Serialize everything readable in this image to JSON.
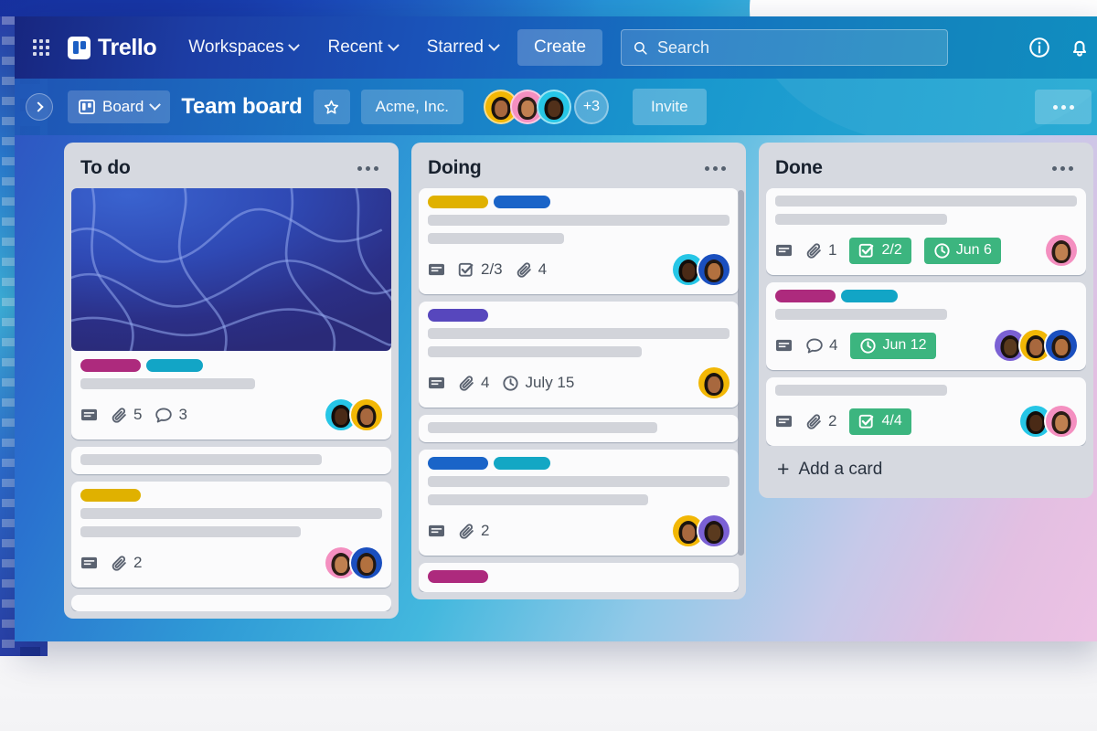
{
  "app": {
    "brand": "Trello",
    "nav": {
      "apps_icon": "grid-apps-icon",
      "workspaces": "Workspaces",
      "recent": "Recent",
      "starred": "Starred",
      "create": "Create",
      "search_placeholder": "Search",
      "search_value": "",
      "info_icon": "info-circle-icon",
      "notifications_icon": "bell-icon"
    },
    "board_header": {
      "sidebar_toggle_icon": "chevron-right-icon",
      "view_label": "Board",
      "view_icon": "board-view-icon",
      "title": "Team board",
      "star_icon": "star-icon",
      "workspace": "Acme, Inc.",
      "members_overflow": "+3",
      "invite": "Invite",
      "more_icon": "ellipsis-icon",
      "member_avatars": [
        {
          "name": "member-1",
          "bg": "#f2b705",
          "hair": "#1b1410",
          "skin": "#a8683e"
        },
        {
          "name": "member-2",
          "bg": "#f48fc0",
          "hair": "#2a1d16",
          "skin": "#c08050"
        },
        {
          "name": "member-3",
          "bg": "#26c6e6",
          "hair": "#140f0c",
          "skin": "#51301a"
        }
      ]
    }
  },
  "colors": {
    "label_magenta": "#ad2a7d",
    "label_cyan": "#12a5c6",
    "label_yellow": "#e0b100",
    "label_blue": "#1a64c8",
    "label_purple": "#5747bd",
    "label_teal": "#13a7c4",
    "badge_green": "#3cb57f",
    "list_bg": "#d6d9e0",
    "card_bg": "#fbfbfc"
  },
  "lists": [
    {
      "id": "list-todo",
      "title": "To do",
      "menu_icon": "ellipsis-icon",
      "has_scrollbar": false,
      "cards": [
        {
          "id": "todo-card-1",
          "cover": true,
          "labels": [
            "#ad2a7d",
            "#12a5c6"
          ],
          "lines": [
            58
          ],
          "meta": [
            {
              "icon": "description-icon",
              "text": ""
            },
            {
              "icon": "attachment-icon",
              "text": "5"
            },
            {
              "icon": "comment-icon",
              "text": "3"
            }
          ],
          "badges": [],
          "avatars": [
            {
              "name": "avatar-cyan",
              "bg": "#26c6e6",
              "hair": "#120d0a",
              "skin": "#4a2a16"
            },
            {
              "name": "avatar-yellow",
              "bg": "#f2b705",
              "hair": "#1b1410",
              "skin": "#a8683e"
            }
          ]
        },
        {
          "id": "todo-card-2",
          "cover": false,
          "labels": [],
          "lines": [
            80
          ],
          "meta": [],
          "badges": [],
          "avatars": []
        },
        {
          "id": "todo-card-3",
          "cover": false,
          "labels": [
            "#e0b100"
          ],
          "lines": [
            100,
            73
          ],
          "meta": [
            {
              "icon": "description-icon",
              "text": ""
            },
            {
              "icon": "attachment-icon",
              "text": "2"
            }
          ],
          "badges": [],
          "avatars": [
            {
              "name": "avatar-pink",
              "bg": "#f48fc0",
              "hair": "#2a1d16",
              "skin": "#c08050"
            },
            {
              "name": "avatar-blue",
              "bg": "#1a4fbf",
              "hair": "#221812",
              "skin": "#b2713f"
            }
          ]
        },
        {
          "id": "todo-card-4",
          "cover": false,
          "labels": [],
          "lines": [],
          "meta": [],
          "badges": [],
          "avatars": []
        }
      ]
    },
    {
      "id": "list-doing",
      "title": "Doing",
      "menu_icon": "ellipsis-icon",
      "has_scrollbar": true,
      "cards": [
        {
          "id": "doing-card-1",
          "cover": false,
          "labels": [
            "#e0b100",
            "#1a64c8"
          ],
          "lines": [
            100,
            45
          ],
          "meta": [
            {
              "icon": "description-icon",
              "text": ""
            },
            {
              "icon": "checklist-icon",
              "text": "2/3"
            },
            {
              "icon": "attachment-icon",
              "text": "4"
            }
          ],
          "badges": [],
          "avatars": [
            {
              "name": "avatar-cyan",
              "bg": "#26c6e6",
              "hair": "#120d0a",
              "skin": "#4a2a16"
            },
            {
              "name": "avatar-blue",
              "bg": "#1a4fbf",
              "hair": "#221812",
              "skin": "#b2713f"
            }
          ]
        },
        {
          "id": "doing-card-2",
          "cover": false,
          "labels": [
            "#5747bd"
          ],
          "lines": [
            100,
            71
          ],
          "meta": [
            {
              "icon": "description-icon",
              "text": ""
            },
            {
              "icon": "attachment-icon",
              "text": "4"
            },
            {
              "icon": "clock-icon",
              "text": "July 15"
            }
          ],
          "badges": [],
          "avatars": [
            {
              "name": "avatar-yellow",
              "bg": "#f2b705",
              "hair": "#1b1410",
              "skin": "#a8683e"
            }
          ]
        },
        {
          "id": "doing-card-3",
          "cover": false,
          "labels": [],
          "lines": [
            76
          ],
          "meta": [],
          "badges": [],
          "avatars": []
        },
        {
          "id": "doing-card-4",
          "cover": false,
          "labels": [
            "#1a64c8",
            "#13a7c4"
          ],
          "lines": [
            100,
            73
          ],
          "meta": [
            {
              "icon": "description-icon",
              "text": ""
            },
            {
              "icon": "attachment-icon",
              "text": "2"
            }
          ],
          "badges": [],
          "avatars": [
            {
              "name": "avatar-yellow",
              "bg": "#f2b705",
              "hair": "#1b1410",
              "skin": "#a8683e"
            },
            {
              "name": "avatar-purple",
              "bg": "#7b61d4",
              "hair": "#1a1210",
              "skin": "#5a3a1e"
            }
          ]
        },
        {
          "id": "doing-card-5",
          "cover": false,
          "labels": [
            "#ad2a7d"
          ],
          "lines": [],
          "meta": [],
          "badges": [],
          "avatars": []
        }
      ]
    },
    {
      "id": "list-done",
      "title": "Done",
      "menu_icon": "ellipsis-icon",
      "has_scrollbar": false,
      "add_card_label": "Add a card",
      "add_card_icon": "plus-icon",
      "cards": [
        {
          "id": "done-card-1",
          "cover": false,
          "labels": [],
          "lines": [
            100,
            57
          ],
          "meta": [
            {
              "icon": "description-icon",
              "text": ""
            },
            {
              "icon": "attachment-icon",
              "text": "1"
            }
          ],
          "badges": [
            {
              "icon": "checklist-icon",
              "text": "2/2"
            },
            {
              "icon": "clock-icon",
              "text": "Jun 6"
            }
          ],
          "avatars": [
            {
              "name": "avatar-pink",
              "bg": "#f48fc0",
              "hair": "#2a1d16",
              "skin": "#c08050"
            }
          ]
        },
        {
          "id": "done-card-2",
          "cover": false,
          "labels": [
            "#ad2a7d",
            "#12a5c6"
          ],
          "lines": [
            57
          ],
          "meta": [
            {
              "icon": "description-icon",
              "text": ""
            },
            {
              "icon": "comment-icon",
              "text": "4"
            }
          ],
          "badges": [
            {
              "icon": "clock-icon",
              "text": "Jun 12"
            }
          ],
          "avatars": [
            {
              "name": "avatar-purple",
              "bg": "#7b61d4",
              "hair": "#1a1210",
              "skin": "#5a3a1e"
            },
            {
              "name": "avatar-yellow",
              "bg": "#f2b705",
              "hair": "#1b1410",
              "skin": "#a8683e"
            },
            {
              "name": "avatar-blue",
              "bg": "#1a4fbf",
              "hair": "#221812",
              "skin": "#b2713f"
            }
          ]
        },
        {
          "id": "done-card-3",
          "cover": false,
          "labels": [],
          "lines": [
            57
          ],
          "meta": [
            {
              "icon": "description-icon",
              "text": ""
            },
            {
              "icon": "attachment-icon",
              "text": "2"
            }
          ],
          "badges": [
            {
              "icon": "checklist-icon",
              "text": "4/4"
            }
          ],
          "avatars": [
            {
              "name": "avatar-cyan",
              "bg": "#26c6e6",
              "hair": "#120d0a",
              "skin": "#4a2a16"
            },
            {
              "name": "avatar-pink",
              "bg": "#f48fc0",
              "hair": "#2a1d16",
              "skin": "#c08050"
            }
          ]
        }
      ]
    }
  ]
}
